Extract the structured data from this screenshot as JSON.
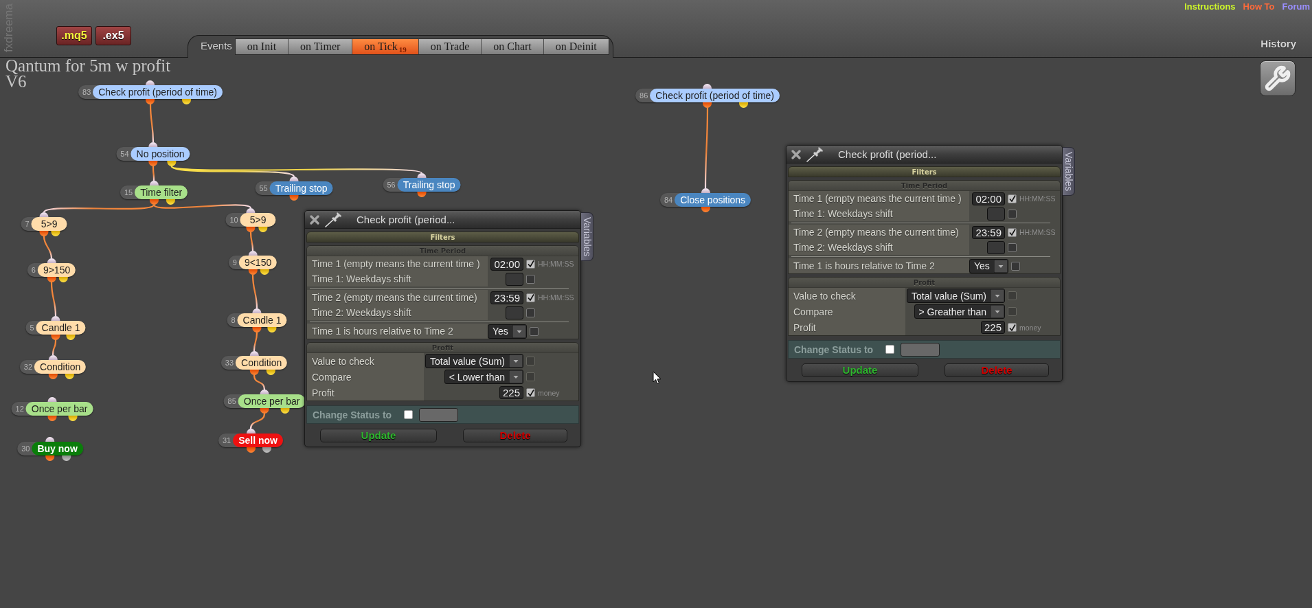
{
  "header": {
    "brand": "fxdreema",
    "file_buttons": [
      {
        "label": ".mq5",
        "kind": "source"
      },
      {
        "label": ".ex5",
        "kind": "compiled"
      }
    ],
    "events_label": "Events",
    "tabs": [
      {
        "label": "on Init",
        "selected": false
      },
      {
        "label": "on Timer",
        "selected": false
      },
      {
        "label": "on Tick",
        "selected": true,
        "count": "19"
      },
      {
        "label": "on Trade",
        "selected": false
      },
      {
        "label": "on Chart",
        "selected": false
      },
      {
        "label": "on Deinit",
        "selected": false
      }
    ],
    "links": [
      {
        "label": "Instructions",
        "color": "#ccf52a"
      },
      {
        "label": "How To",
        "color": "#ff6a3a"
      },
      {
        "label": "Forum",
        "color": "#9a8fff"
      }
    ],
    "history": "History"
  },
  "project_title_lines": [
    "Qantum for 5m w profit",
    "V6"
  ],
  "diagram": {
    "nodes": [
      {
        "number": "83",
        "label": "Check profit (period of time)",
        "kind": "condition",
        "color": "#aaccff",
        "children": [
          {
            "number": "54",
            "label": "No position",
            "kind": "condition",
            "color": "#aaccff",
            "from_yellow_output": false,
            "children": [
              {
                "number": "15",
                "label": "Time filter",
                "kind": "condition",
                "color": "#a8e08a",
                "from_yellow_output": false,
                "children": [
                  {
                    "number": "7",
                    "label": "5>9",
                    "kind": "condition",
                    "color": "#ffdcaa",
                    "from_yellow_output": false,
                    "children": [
                      {
                        "number": "6",
                        "label": "9>150",
                        "kind": "condition",
                        "color": "#ffdcaa",
                        "from_yellow_output": false,
                        "children": [
                          {
                            "number": "5",
                            "label": "Candle 1",
                            "kind": "condition",
                            "color": "#ffdcaa",
                            "from_yellow_output": false,
                            "children": [
                              {
                                "number": "32",
                                "label": "Condition",
                                "kind": "condition",
                                "color": "#ffdcaa",
                                "from_yellow_output": false
                              }
                            ]
                          }
                        ]
                      }
                    ]
                  },
                  {
                    "number": "10",
                    "label": "5>9",
                    "kind": "condition",
                    "color": "#ffdcaa",
                    "from_yellow_output": false,
                    "children": [
                      {
                        "number": "9",
                        "label": "9<150",
                        "kind": "condition",
                        "color": "#ffdcaa",
                        "from_yellow_output": false,
                        "children": [
                          {
                            "number": "8",
                            "label": "Candle 1",
                            "kind": "condition",
                            "color": "#ffdcaa",
                            "from_yellow_output": false,
                            "children": [
                              {
                                "number": "33",
                                "label": "Condition",
                                "kind": "condition",
                                "color": "#ffdcaa",
                                "from_yellow_output": false,
                                "children": [
                                  {
                                    "number": "85",
                                    "label": "Once per bar",
                                    "kind": "condition",
                                    "color": "#a8e08a",
                                    "from_yellow_output": false,
                                    "children": [
                                      {
                                        "number": "31",
                                        "label": "Sell now",
                                        "kind": "order",
                                        "color": "#ee1111",
                                        "from_yellow_output": false
                                      }
                                    ]
                                  }
                                ]
                              }
                            ]
                          }
                        ]
                      }
                    ]
                  }
                ]
              },
              {
                "number": "55",
                "label": "Trailing stop",
                "kind": "action",
                "color": "#4a86c0",
                "from_yellow_output": true
              },
              {
                "number": "56",
                "label": "Trailing stop",
                "kind": "action",
                "color": "#4a86c0",
                "from_yellow_output": true
              }
            ]
          }
        ]
      },
      {
        "number": "86",
        "label": "Check profit (period of time)",
        "kind": "condition",
        "color": "#aaccff",
        "children": [
          {
            "number": "84",
            "label": "Close positions",
            "kind": "action",
            "color": "#4a86c0",
            "from_yellow_output": false
          }
        ]
      },
      {
        "number": "12",
        "label": "Once per bar",
        "kind": "condition",
        "color": "#a8e08a"
      },
      {
        "number": "30",
        "label": "Buy now",
        "kind": "order",
        "color": "#0a7d0a"
      }
    ]
  },
  "dialogs": [
    {
      "title": "Check profit (period...",
      "variables_tab": "Variables",
      "filters_title": "Filters",
      "sections": [
        {
          "title": "Time Period",
          "groups": [
            {
              "rows": [
                {
                  "label": "Time 1 (empty means the current time )",
                  "control": {
                    "kind": "input",
                    "value": "02:00"
                  },
                  "checkbox": {
                    "checked": true,
                    "disabled": false
                  },
                  "unit": "HH:MM:SS"
                },
                {
                  "label": "Time 1: Weekdays shift",
                  "control": {
                    "kind": "input"
                  },
                  "checkbox": {
                    "checked": false,
                    "disabled": false
                  }
                }
              ]
            },
            {
              "rows": [
                {
                  "label": "Time 2 (empty means the current time)",
                  "control": {
                    "kind": "input",
                    "value": "23:59"
                  },
                  "checkbox": {
                    "checked": true,
                    "disabled": false
                  },
                  "unit": "HH:MM:SS"
                },
                {
                  "label": "Time 2: Weekdays shift",
                  "control": {
                    "kind": "input"
                  },
                  "checkbox": {
                    "checked": false,
                    "disabled": false
                  }
                }
              ]
            },
            {
              "rows": [
                {
                  "label": "Time 1 is hours relative to Time 2",
                  "control": {
                    "kind": "select",
                    "value": "Yes"
                  },
                  "checkbox": {
                    "checked": false,
                    "disabled": false
                  }
                }
              ]
            }
          ]
        },
        {
          "title": "Profit",
          "groups": [
            {
              "rows": [
                {
                  "label": "Value to check",
                  "control": {
                    "kind": "select",
                    "value": "Total value (Sum)"
                  },
                  "checkbox": {
                    "checked": false,
                    "disabled": true
                  }
                },
                {
                  "label": "Compare",
                  "control": {
                    "kind": "select",
                    "value": "< Lower than"
                  },
                  "checkbox": {
                    "checked": false,
                    "disabled": true
                  }
                },
                {
                  "label": "Profit",
                  "control": {
                    "kind": "input",
                    "value": "225"
                  },
                  "checkbox": {
                    "checked": true,
                    "disabled": false
                  },
                  "unit": "money"
                }
              ]
            }
          ]
        }
      ],
      "status": {
        "label": "Change Status to",
        "checked": false
      },
      "buttons": [
        {
          "label": "Update",
          "kind": "update"
        },
        {
          "label": "Delete",
          "kind": "delete"
        }
      ]
    },
    {
      "title": "Check profit (period...",
      "variables_tab": "Variables",
      "filters_title": "Filters",
      "sections": [
        {
          "title": "Time Period",
          "groups": [
            {
              "rows": [
                {
                  "label": "Time 1 (empty means the current time )",
                  "control": {
                    "kind": "input",
                    "value": "02:00"
                  },
                  "checkbox": {
                    "checked": true,
                    "disabled": false
                  },
                  "unit": "HH:MM:SS"
                },
                {
                  "label": "Time 1: Weekdays shift",
                  "control": {
                    "kind": "input"
                  },
                  "checkbox": {
                    "checked": false,
                    "disabled": false
                  }
                }
              ]
            },
            {
              "rows": [
                {
                  "label": "Time 2 (empty means the current time)",
                  "control": {
                    "kind": "input",
                    "value": "23:59"
                  },
                  "checkbox": {
                    "checked": true,
                    "disabled": false
                  },
                  "unit": "HH:MM:SS"
                },
                {
                  "label": "Time 2: Weekdays shift",
                  "control": {
                    "kind": "input"
                  },
                  "checkbox": {
                    "checked": false,
                    "disabled": false
                  }
                }
              ]
            },
            {
              "rows": [
                {
                  "label": "Time 1 is hours relative to Time 2",
                  "control": {
                    "kind": "select",
                    "value": "Yes"
                  },
                  "checkbox": {
                    "checked": false,
                    "disabled": false
                  }
                }
              ]
            }
          ]
        },
        {
          "title": "Profit",
          "groups": [
            {
              "rows": [
                {
                  "label": "Value to check",
                  "control": {
                    "kind": "select",
                    "value": "Total value (Sum)"
                  },
                  "checkbox": {
                    "checked": false,
                    "disabled": true
                  }
                },
                {
                  "label": "Compare",
                  "control": {
                    "kind": "select",
                    "value": "> Greather than"
                  },
                  "checkbox": {
                    "checked": false,
                    "disabled": true
                  }
                },
                {
                  "label": "Profit",
                  "control": {
                    "kind": "input",
                    "value": "225"
                  },
                  "checkbox": {
                    "checked": true,
                    "disabled": false
                  },
                  "unit": "money"
                }
              ]
            }
          ]
        }
      ],
      "status": {
        "label": "Change Status to",
        "checked": false
      },
      "buttons": [
        {
          "label": "Update",
          "kind": "update"
        },
        {
          "label": "Delete",
          "kind": "delete"
        }
      ]
    }
  ]
}
